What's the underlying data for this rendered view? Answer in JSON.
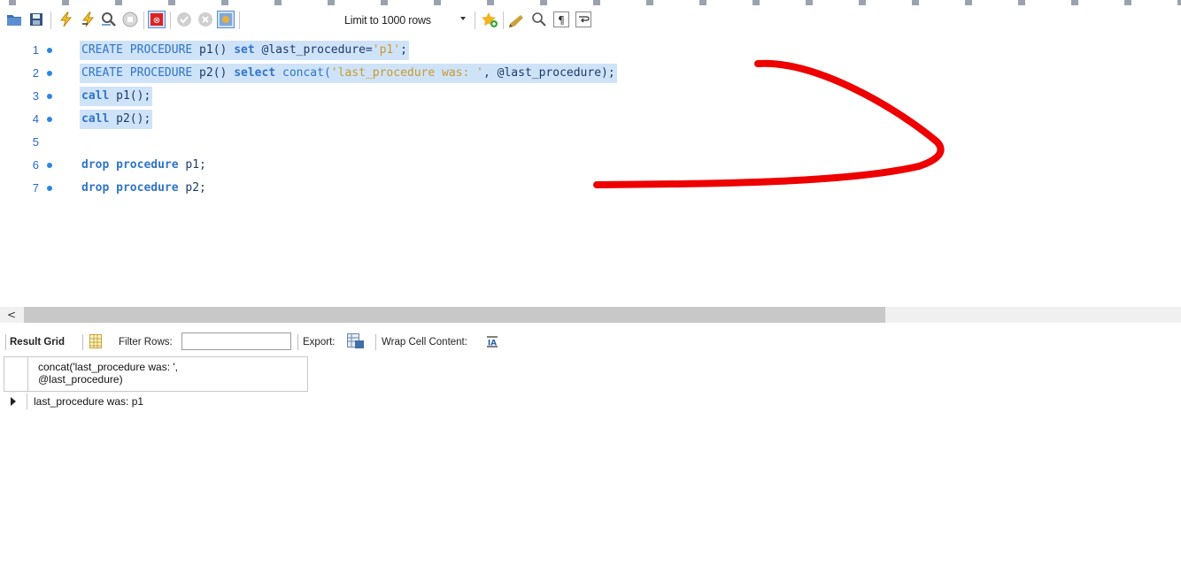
{
  "toolbar": {
    "limit_label": "Limit to 1000 rows",
    "icons": [
      "open-folder-icon",
      "save-icon",
      "execute-icon",
      "execute-current-icon",
      "explain-icon",
      "stop-icon",
      "toggle-error-icon",
      "commit-icon",
      "rollback-icon",
      "autocommit-icon",
      "add-snippet-icon",
      "beautify-icon",
      "find-icon",
      "invisible-chars-icon",
      "word-wrap-icon"
    ]
  },
  "editor": {
    "lines": [
      {
        "num": "1",
        "has_dot": true
      },
      {
        "num": "2",
        "has_dot": true
      },
      {
        "num": "3",
        "has_dot": true
      },
      {
        "num": "4",
        "has_dot": true
      },
      {
        "num": "5",
        "has_dot": false
      },
      {
        "num": "6",
        "has_dot": true
      },
      {
        "num": "7",
        "has_dot": true
      }
    ],
    "l1": {
      "kw1": "CREATE PROCEDURE",
      "name": " p1() ",
      "kw2": "set",
      "var": " @last_procedure=",
      "str": "'p1'",
      "end": ";"
    },
    "l2": {
      "kw1": "CREATE PROCEDURE",
      "name": " p2() ",
      "kw2": "select",
      "fn": " concat(",
      "str": "'last_procedure was: '",
      "var": ", @last_procedure);"
    },
    "l3": {
      "kw": "call",
      "rest": " p1();"
    },
    "l4": {
      "kw": "call",
      "rest": " p2();"
    },
    "l6": {
      "kw": "drop procedure",
      "rest": " p1;"
    },
    "l7": {
      "kw": "drop procedure",
      "rest": " p2;"
    }
  },
  "results_toolbar": {
    "result_grid_label": "Result Grid",
    "filter_label": "Filter Rows:",
    "filter_value": "",
    "export_label": "Export:",
    "wrap_label": "Wrap Cell Content:"
  },
  "grid": {
    "header_line1": "concat('last_procedure was: ',",
    "header_line2": "@last_procedure)",
    "rows": [
      "last_procedure was: p1"
    ]
  },
  "annotation_color": "#ee0000"
}
